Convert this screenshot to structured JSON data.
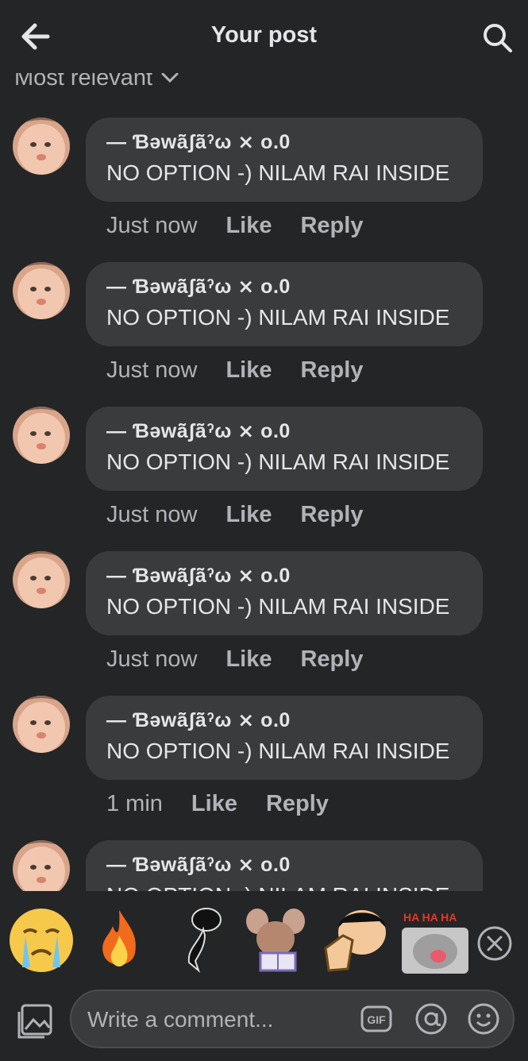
{
  "header": {
    "title": "Your post",
    "back_icon": "arrow-left-icon",
    "search_icon": "search-icon"
  },
  "sort": {
    "label": "Most relevant"
  },
  "comments": [
    {
      "author": "— Ɓəwã̃ʃã̃ˀω ⨯  o.0",
      "text": "NO OPTION -) NILAM RAI INSIDE",
      "time": "Just now",
      "like": "Like",
      "reply": "Reply"
    },
    {
      "author": "— Ɓəwã̃ʃã̃ˀω ⨯  o.0",
      "text": "NO OPTION -) NILAM RAI INSIDE",
      "time": "Just now",
      "like": "Like",
      "reply": "Reply"
    },
    {
      "author": "— Ɓəwã̃ʃã̃ˀω ⨯  o.0",
      "text": "NO OPTION -) NILAM RAI INSIDE",
      "time": "Just now",
      "like": "Like",
      "reply": "Reply"
    },
    {
      "author": "— Ɓəwã̃ʃã̃ˀω ⨯  o.0",
      "text": "NO OPTION -) NILAM RAI INSIDE",
      "time": "Just now",
      "like": "Like",
      "reply": "Reply"
    },
    {
      "author": "— Ɓəwã̃ʃã̃ˀω ⨯  o.0",
      "text": "NO OPTION -) NILAM RAI INSIDE",
      "time": "1 min",
      "like": "Like",
      "reply": "Reply"
    },
    {
      "author": "— Ɓəwã̃ʃã̃ˀω ⨯  o.0",
      "text": "NO OPTION -) NILAM RAI INSIDE",
      "time": "",
      "like": "",
      "reply": ""
    }
  ],
  "stickers": [
    "crying-face-sticker",
    "fire-sticker",
    "dancing-silhouette-sticker",
    "mouse-reading-book-sticker",
    "thumbs-up-boy-sticker",
    "laughing-cat-haha-sticker"
  ],
  "composer": {
    "placeholder": "Write a comment...",
    "gif_label": "GIF"
  },
  "colors": {
    "background": "#242526",
    "bubble": "#3a3b3c",
    "text_primary": "#e4e6eb",
    "text_secondary": "#b0b3b8"
  }
}
